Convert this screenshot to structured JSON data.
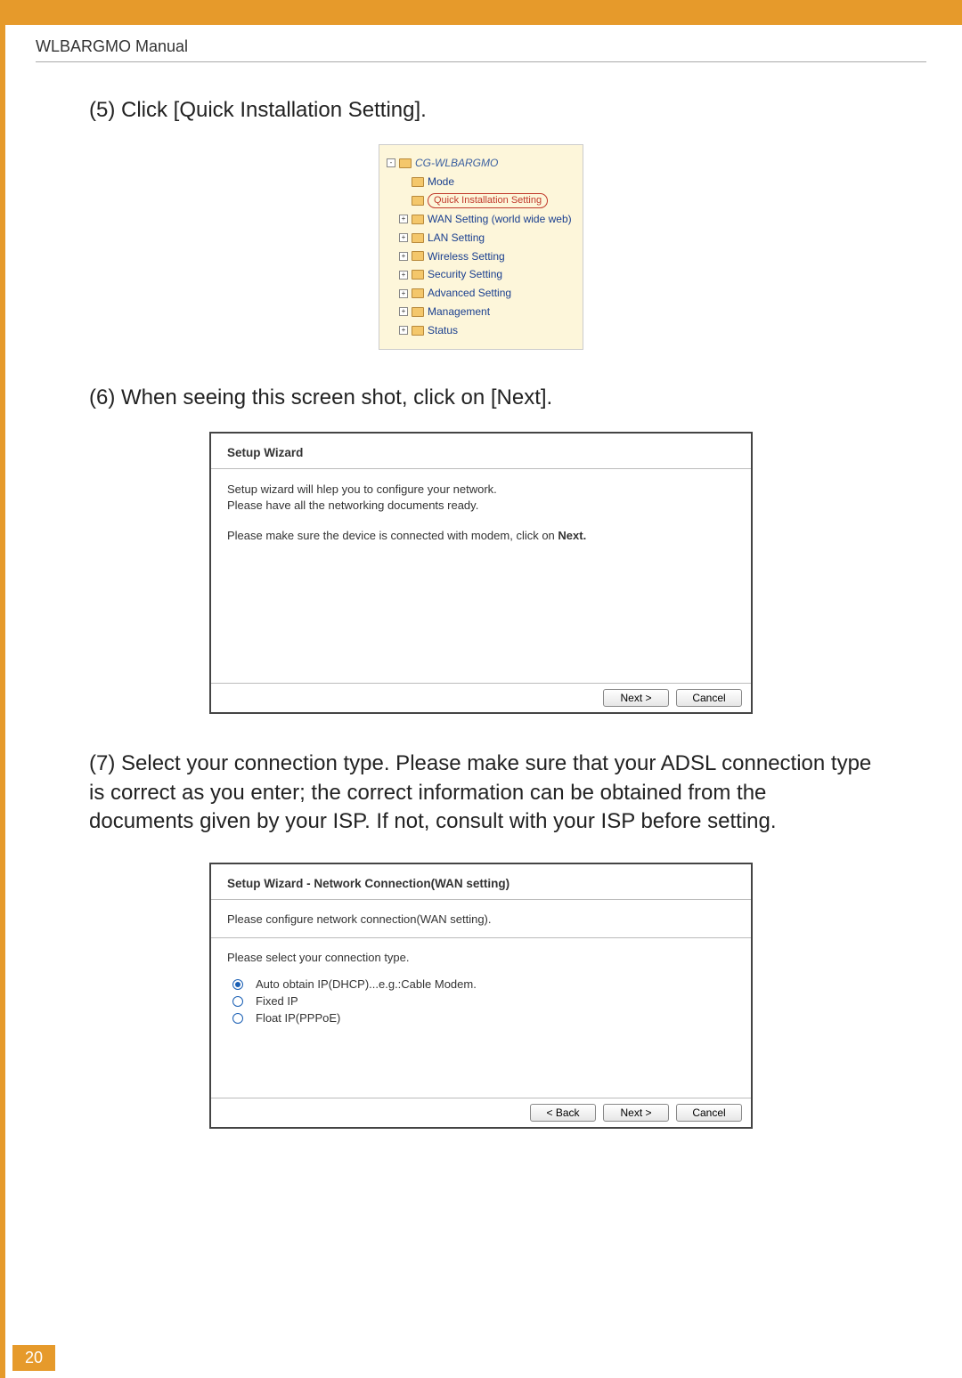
{
  "header": {
    "title": "WLBARGMO Manual"
  },
  "steps": {
    "s5": "(5) Click [Quick Installation Setting].",
    "s6": "(6) When seeing this screen shot, click on [Next].",
    "s7": "(7) Select your connection type. Please make sure that your ADSL connection type is correct as you enter; the correct information can be obtained from the documents given by your ISP. If not, consult with your ISP before setting."
  },
  "tree": {
    "root": "CG-WLBARGMO",
    "items": [
      {
        "label": "Mode",
        "expandable": false,
        "indent": 1,
        "highlight": false
      },
      {
        "label": "Quick Installation Setting",
        "expandable": false,
        "indent": 2,
        "highlight": true
      },
      {
        "label": "WAN Setting (world wide web)",
        "expandable": true,
        "indent": 1,
        "highlight": false
      },
      {
        "label": "LAN Setting",
        "expandable": true,
        "indent": 1,
        "highlight": false
      },
      {
        "label": "Wireless Setting",
        "expandable": true,
        "indent": 1,
        "highlight": false
      },
      {
        "label": "Security Setting",
        "expandable": true,
        "indent": 1,
        "highlight": false
      },
      {
        "label": "Advanced Setting",
        "expandable": true,
        "indent": 1,
        "highlight": false
      },
      {
        "label": "Management",
        "expandable": true,
        "indent": 1,
        "highlight": false
      },
      {
        "label": "Status",
        "expandable": true,
        "indent": 1,
        "highlight": false
      }
    ]
  },
  "wizard1": {
    "title": "Setup Wizard",
    "line1": "Setup wizard will hlep you to configure your network.",
    "line2": "Please have all the networking documents ready.",
    "line3_a": "Please make sure the device is connected with modem, click on ",
    "line3_b": "Next.",
    "buttons": {
      "next": "Next >",
      "cancel": "Cancel"
    }
  },
  "wizard2": {
    "title": "Setup Wizard - Network Connection(WAN setting)",
    "sub": "Please configure network connection(WAN setting).",
    "prompt": "Please select your connection type.",
    "opts": [
      {
        "label": "Auto obtain IP(DHCP)...e.g.:Cable Modem.",
        "selected": true
      },
      {
        "label": "Fixed IP",
        "selected": false
      },
      {
        "label": "Float IP(PPPoE)",
        "selected": false
      }
    ],
    "buttons": {
      "back": "< Back",
      "next": "Next >",
      "cancel": "Cancel"
    }
  },
  "page_number": "20"
}
